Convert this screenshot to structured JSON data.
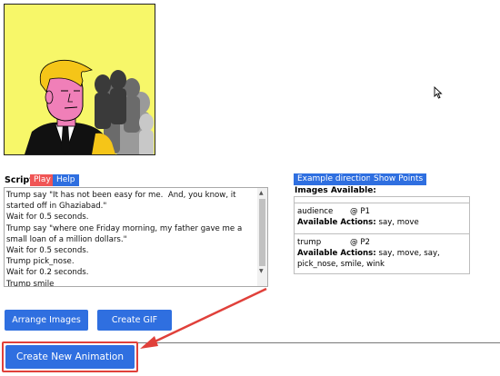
{
  "script": {
    "label": "Script",
    "play_label": "Play",
    "help_label": "Help",
    "lines": "Trump say \"It has not been easy for me.  And, you know, it started off in Ghaziabad.\"\nWait for 0.5 seconds.\nTrump say \"where one Friday morning, my father gave me a small loan of a million dollars.\"\nWait for 0.5 seconds.\nTrump pick_nose.\nWait for 0.2 seconds.\nTrump smile"
  },
  "toolbar": {
    "example_directions_label": "Example directions",
    "show_points_label": "Show Points"
  },
  "images": {
    "title": "Images Available:",
    "available_actions_label": "Available Actions:",
    "items": [
      {
        "name": "audience",
        "player": "@ P1",
        "actions": "say, move"
      },
      {
        "name": "trump",
        "player": "@ P2",
        "actions": "say, move, say, pick_nose, smile, wink"
      }
    ]
  },
  "buttons": {
    "arrange_images": "Arrange Images",
    "create_gif": "Create GIF",
    "create_new_animation": "Create New Animation"
  },
  "colors": {
    "canvas_bg": "#f7f769",
    "button_blue": "#2f6fe0",
    "play_red": "#f05555",
    "highlight_red": "#e0403a"
  }
}
